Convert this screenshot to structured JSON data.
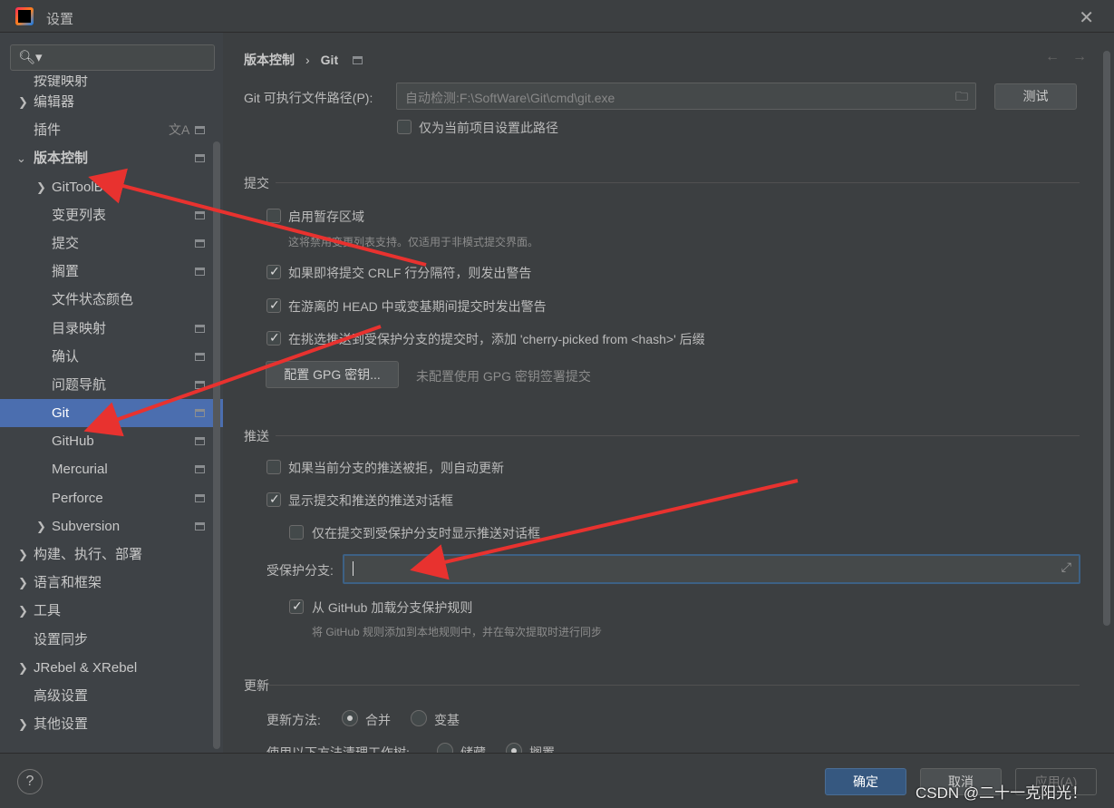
{
  "window": {
    "title": "设置",
    "close": "✕"
  },
  "sidebar": {
    "search_placeholder": "",
    "items": [
      {
        "label": "按键映射"
      },
      {
        "label": "编辑器"
      },
      {
        "label": "插件"
      },
      {
        "label": "版本控制"
      },
      {
        "label": "GitToolBox"
      },
      {
        "label": "变更列表"
      },
      {
        "label": "提交"
      },
      {
        "label": "搁置"
      },
      {
        "label": "文件状态颜色"
      },
      {
        "label": "目录映射"
      },
      {
        "label": "确认"
      },
      {
        "label": "问题导航"
      },
      {
        "label": "Git"
      },
      {
        "label": "GitHub"
      },
      {
        "label": "Mercurial"
      },
      {
        "label": "Perforce"
      },
      {
        "label": "Subversion"
      },
      {
        "label": "构建、执行、部署"
      },
      {
        "label": "语言和框架"
      },
      {
        "label": "工具"
      },
      {
        "label": "设置同步"
      },
      {
        "label": "JRebel & XRebel"
      },
      {
        "label": "高级设置"
      },
      {
        "label": "其他设置"
      }
    ]
  },
  "breadcrumb": {
    "parent": "版本控制",
    "sep": "›",
    "current": "Git"
  },
  "git_path": {
    "label": "Git 可执行文件路径(P):",
    "value": "自动检测:F:\\SoftWare\\Git\\cmd\\git.exe",
    "test_button": "测试",
    "project_only": "仅为当前项目设置此路径"
  },
  "commit": {
    "title": "提交",
    "staging": "启用暂存区域",
    "staging_hint": "这将禁用变更列表支持。仅适用于非模式提交界面。",
    "crlf": "如果即将提交 CRLF 行分隔符，则发出警告",
    "detached": "在游离的 HEAD 中或变基期间提交时发出警告",
    "cherry": "在挑选推送到受保护分支的提交时，添加 'cherry-picked from <hash>' 后缀",
    "gpg_button": "配置 GPG 密钥...",
    "gpg_hint": "未配置使用 GPG 密钥签署提交"
  },
  "push": {
    "title": "推送",
    "auto_update": "如果当前分支的推送被拒，则自动更新",
    "show_dialog": "显示提交和推送的推送对话框",
    "protected_only": "仅在提交到受保护分支时显示推送对话框",
    "protected_label": "受保护分支:",
    "protected_value": "",
    "load_github": "从 GitHub 加载分支保护规则",
    "load_github_hint": "将 GitHub 规则添加到本地规则中，并在每次提取时进行同步"
  },
  "update": {
    "title": "更新",
    "method_label": "更新方法:",
    "merge": "合并",
    "rebase": "变基",
    "clean_label": "使用以下方法清理工作树:",
    "stash": "储藏",
    "shelve": "搁置"
  },
  "footer": {
    "help": "?",
    "ok": "确定",
    "cancel": "取消",
    "apply": "应用(A)"
  },
  "watermark": "CSDN @二十一克阳光！",
  "colors": {
    "selection": "#4b6eaf",
    "arrow": "#e8322f",
    "primary_button": "#365880"
  }
}
